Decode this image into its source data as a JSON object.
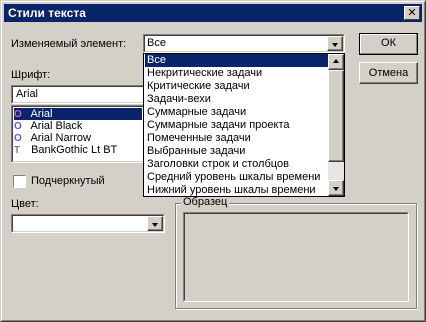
{
  "window": {
    "title": "Стили текста",
    "close_glyph": "✕"
  },
  "element_label": "Изменяемый элемент:",
  "element_combo": {
    "value": "Все",
    "options": [
      "Все",
      "Некритические задачи",
      "Критические задачи",
      "Задачи-вехи",
      "Суммарные задачи",
      "Суммарные задачи проекта",
      "Помеченные задачи",
      "Выбранные задачи",
      "Заголовки строк и столбцов",
      "Средний уровень шкалы времени",
      "Нижний уровень шкалы времени"
    ],
    "selected_index": 0
  },
  "font_label": "Шрифт:",
  "font_input_value": "Arial",
  "font_list": [
    {
      "name": "Arial",
      "icon": "opentype-icon",
      "glyph": "O",
      "selected": true
    },
    {
      "name": "Arial Black",
      "icon": "opentype-icon",
      "glyph": "O",
      "selected": false
    },
    {
      "name": "Arial Narrow",
      "icon": "opentype-icon",
      "glyph": "O",
      "selected": false
    },
    {
      "name": "BankGothic Lt BT",
      "icon": "truetype-icon",
      "glyph": "T",
      "selected": false
    }
  ],
  "underline_label": "Подчеркнутый",
  "color_label": "Цвет:",
  "color_value": "",
  "sample_label": "Образец",
  "buttons": {
    "ok": "ОК",
    "cancel": "Отмена"
  },
  "colors": {
    "title_bar": "#0a246a",
    "face": "#d4d0c8",
    "selection": "#0a246a"
  }
}
